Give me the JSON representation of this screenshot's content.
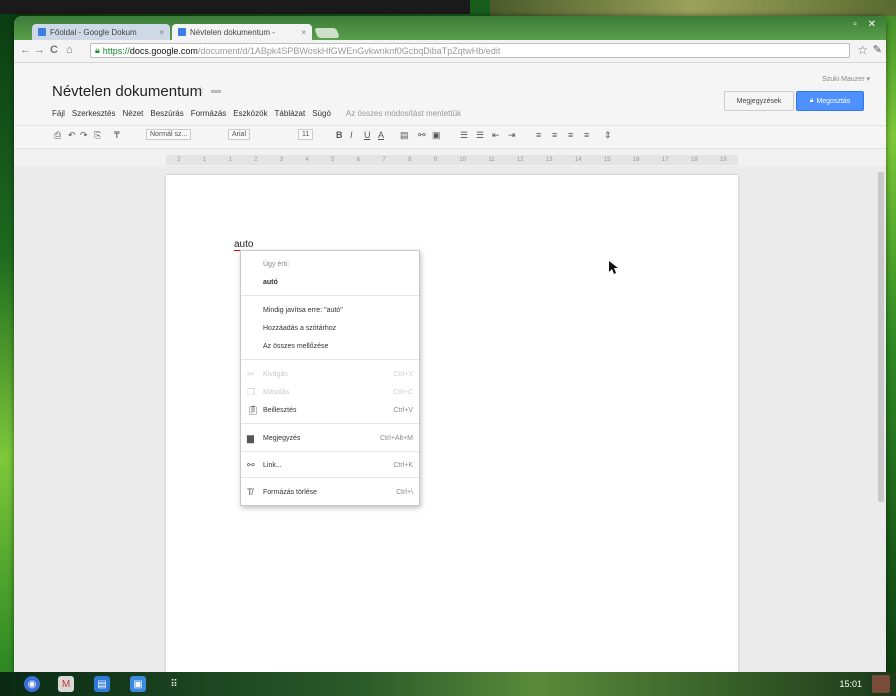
{
  "browser": {
    "tabs": [
      {
        "label": "Főoldal - Google Dokum",
        "close": "×"
      },
      {
        "label": "Névtelen dokumentum - ",
        "close": "×"
      }
    ],
    "url": {
      "scheme": "https://",
      "host": "docs.google.com",
      "path": "/document/d/1ABpk4SPBWoskHfGWEnGvkwnknf0GcbqDibaTpZqtwHb/edit"
    }
  },
  "docs": {
    "title": "Névtelen dokumentum",
    "user": "Szuki Mauzer ▾",
    "comments_label": "Megjegyzések",
    "share_label": "Megosztás",
    "menu": [
      "Fájl",
      "Szerkesztés",
      "Nézet",
      "Beszúrás",
      "Formázás",
      "Eszközök",
      "Táblázat",
      "Súgó"
    ],
    "saved_status": "Az összes módosítást mentettük",
    "toolbar": {
      "style": "Normál sz...",
      "font": "Arial",
      "size": "11"
    },
    "ruler_ticks": [
      "2",
      "1",
      "1",
      "2",
      "3",
      "4",
      "5",
      "6",
      "7",
      "8",
      "9",
      "10",
      "11",
      "12",
      "13",
      "14",
      "15",
      "16",
      "17",
      "18",
      "19"
    ],
    "body_word": "auto"
  },
  "context_menu": {
    "header": "Úgy érti:",
    "suggestion": "autó",
    "always_correct": "Mindig javítsa erre: \"autó\"",
    "add_dictionary": "Hozzáadás a szótárhoz",
    "ignore_all": "Az összes mellőzése",
    "cut": {
      "label": "Kivágás",
      "shortcut": "Ctrl+X"
    },
    "copy": {
      "label": "Másolás",
      "shortcut": "Ctrl+C"
    },
    "paste": {
      "label": "Beillesztés",
      "shortcut": "Ctrl+V"
    },
    "comment": {
      "label": "Megjegyzés",
      "shortcut": "Ctrl+Alt+M"
    },
    "link": {
      "label": "Link...",
      "shortcut": "Ctrl+K"
    },
    "clear_format": {
      "label": "Formázás törlése",
      "shortcut": "Ctrl+\\"
    }
  },
  "taskbar": {
    "clock": "15:01"
  }
}
